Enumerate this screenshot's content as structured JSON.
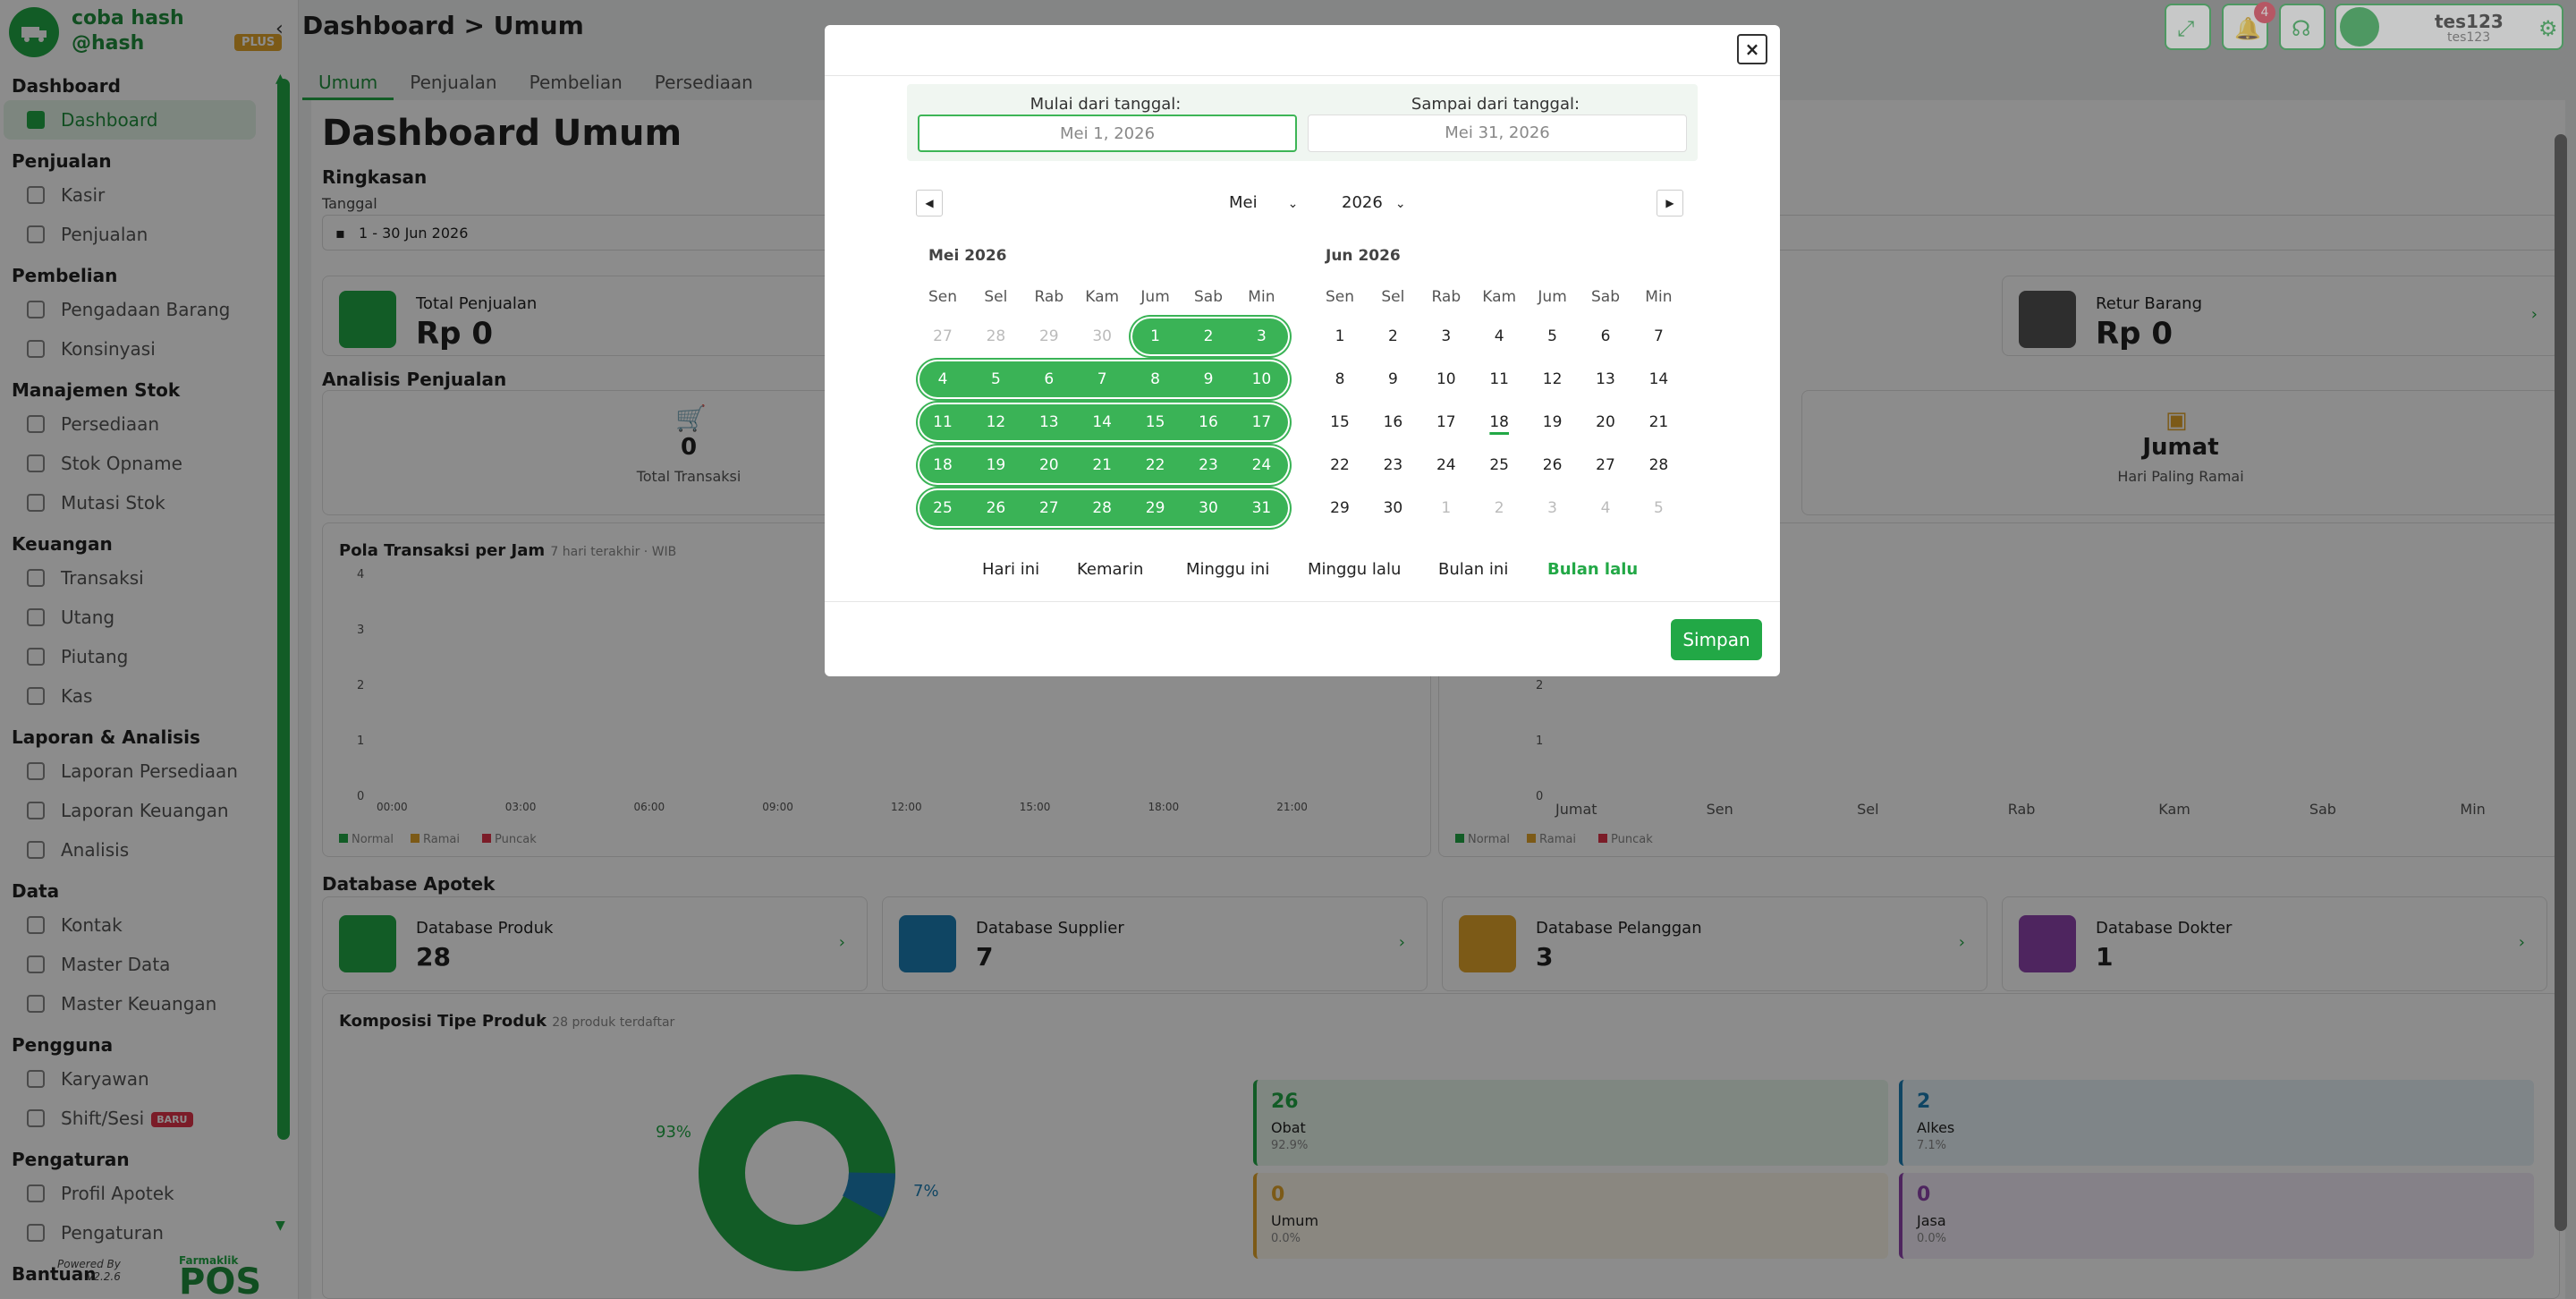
{
  "sidebar": {
    "brand_name": "coba hash",
    "brand_handle": "@hash",
    "plan_badge": "PLUS",
    "groups": [
      {
        "title": "Dashboard",
        "items": [
          {
            "label": "Dashboard",
            "active": true
          }
        ]
      },
      {
        "title": "Penjualan",
        "items": [
          {
            "label": "Kasir"
          },
          {
            "label": "Penjualan"
          }
        ]
      },
      {
        "title": "Pembelian",
        "items": [
          {
            "label": "Pengadaan Barang"
          },
          {
            "label": "Konsinyasi"
          }
        ]
      },
      {
        "title": "Manajemen Stok",
        "items": [
          {
            "label": "Persediaan"
          },
          {
            "label": "Stok Opname"
          },
          {
            "label": "Mutasi Stok"
          }
        ]
      },
      {
        "title": "Keuangan",
        "items": [
          {
            "label": "Transaksi"
          },
          {
            "label": "Utang"
          },
          {
            "label": "Piutang"
          },
          {
            "label": "Kas"
          }
        ]
      },
      {
        "title": "Laporan & Analisis",
        "items": [
          {
            "label": "Laporan Persediaan"
          },
          {
            "label": "Laporan Keuangan"
          },
          {
            "label": "Analisis"
          }
        ]
      },
      {
        "title": "Data",
        "items": [
          {
            "label": "Kontak"
          },
          {
            "label": "Master Data"
          },
          {
            "label": "Master Keuangan"
          }
        ]
      },
      {
        "title": "Pengguna",
        "items": [
          {
            "label": "Karyawan"
          },
          {
            "label": "Shift/Sesi",
            "badge": "BARU"
          }
        ]
      },
      {
        "title": "Pengaturan",
        "items": [
          {
            "label": "Profil Apotek"
          },
          {
            "label": "Pengaturan"
          }
        ]
      },
      {
        "title": "Bantuan",
        "items": []
      }
    ],
    "powered_by": "Powered By",
    "version": "v2.2.6",
    "pos_brand": "POS",
    "pos_brand_small": "Farmaklik"
  },
  "header": {
    "breadcrumb": "Dashboard > Umum",
    "notif_count": "4",
    "user_name": "tes123",
    "user_sub": "tes123"
  },
  "tabs": [
    "Umum",
    "Penjualan",
    "Pembelian",
    "Persediaan"
  ],
  "dashboard": {
    "title": "Dashboard Umum",
    "summary_title": "Ringkasan",
    "date_label": "Tanggal",
    "date_value": "1 - 30 Jun 2026",
    "total_sales_label": "Total Penjualan",
    "total_sales_value": "Rp 0",
    "returns_label": "Retur Barang",
    "returns_value": "Rp 0",
    "analysis_title": "Analisis Penjualan",
    "tx_value": "0",
    "tx_label": "Total Transaksi",
    "busiest_value": "Jumat",
    "busiest_label": "Hari Paling Ramai",
    "pattern_title": "Pola Transaksi per Jam",
    "pattern_sub": "7 hari terakhir · WIB",
    "y_ticks": [
      "4",
      "3",
      "2",
      "1",
      "0"
    ],
    "hour_ticks": [
      "00:00",
      "03:00",
      "06:00",
      "09:00",
      "12:00",
      "15:00",
      "18:00",
      "21:00"
    ],
    "day_ticks": [
      "Jumat",
      "Sen",
      "Sel",
      "Rab",
      "Kam",
      "Sab",
      "Min"
    ],
    "legend": [
      "Normal",
      "Ramai",
      "Puncak"
    ],
    "db_title": "Database Apotek",
    "db_cards": [
      {
        "label": "Database Produk",
        "value": "28",
        "color": "#22a846"
      },
      {
        "label": "Database Supplier",
        "value": "7",
        "color": "#1d7fb5"
      },
      {
        "label": "Database Pelanggan",
        "value": "3",
        "color": "#e2a42a"
      },
      {
        "label": "Database Dokter",
        "value": "1",
        "color": "#8e44ad"
      }
    ],
    "comp_title": "Komposisi Tipe Produk",
    "comp_sub": "28 produk terdaftar",
    "pct_big": "93%",
    "pct_small": "7%",
    "comp_items": [
      {
        "value": "26",
        "label": "Obat",
        "pct": "92.9%",
        "color": "#22a846"
      },
      {
        "value": "2",
        "label": "Alkes",
        "pct": "7.1%",
        "color": "#1d7fb5"
      },
      {
        "value": "0",
        "label": "Umum",
        "pct": "0.0%",
        "color": "#e2a42a"
      },
      {
        "value": "0",
        "label": "Jasa",
        "pct": "0.0%",
        "color": "#8e44ad"
      }
    ]
  },
  "modal": {
    "start_label": "Mulai dari tanggal:",
    "start_value": "Mei 1, 2026",
    "end_label": "Sampai dari tanggal:",
    "end_value": "Mei 31, 2026",
    "month_select": "Mei",
    "year_select": "2026",
    "left_title": "Mei 2026",
    "right_title": "Jun 2026",
    "weekdays": [
      "Sen",
      "Sel",
      "Rab",
      "Kam",
      "Jum",
      "Sab",
      "Min"
    ],
    "may_days": [
      [
        "27",
        "28",
        "29",
        "30",
        "1",
        "2",
        "3"
      ],
      [
        "4",
        "5",
        "6",
        "7",
        "8",
        "9",
        "10"
      ],
      [
        "11",
        "12",
        "13",
        "14",
        "15",
        "16",
        "17"
      ],
      [
        "18",
        "19",
        "20",
        "21",
        "22",
        "23",
        "24"
      ],
      [
        "25",
        "26",
        "27",
        "28",
        "29",
        "30",
        "31"
      ]
    ],
    "jun_days": [
      [
        "1",
        "2",
        "3",
        "4",
        "5",
        "6",
        "7"
      ],
      [
        "8",
        "9",
        "10",
        "11",
        "12",
        "13",
        "14"
      ],
      [
        "15",
        "16",
        "17",
        "18",
        "19",
        "20",
        "21"
      ],
      [
        "22",
        "23",
        "24",
        "25",
        "26",
        "27",
        "28"
      ],
      [
        "29",
        "30",
        "1",
        "2",
        "3",
        "4",
        "5"
      ]
    ],
    "presets": [
      "Hari ini",
      "Kemarin",
      "Minggu ini",
      "Minggu lalu",
      "Bulan ini",
      "Bulan lalu"
    ],
    "save_label": "Simpan",
    "close_label": "×"
  }
}
